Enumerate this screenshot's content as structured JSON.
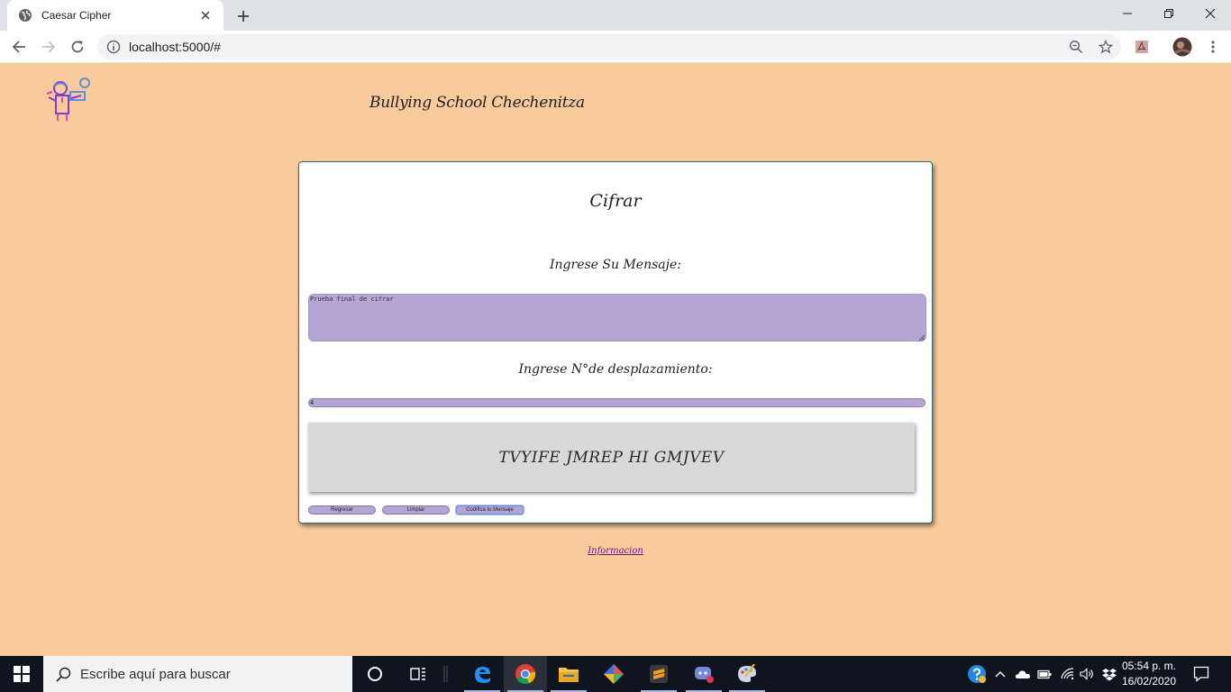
{
  "browser": {
    "tab_title": "Caesar Cipher",
    "url": "localhost:5000/#"
  },
  "page": {
    "brand": "Bullying School Chechenitza",
    "card": {
      "title": "Cifrar",
      "message_label": "Ingrese Su Mensaje:",
      "message_value": "Prueba final de cifrar",
      "shift_label": "Ingrese N°de desplazamiento:",
      "shift_value": "4",
      "result": "TVYIFE JMREP HI GMJVEV",
      "buttons": {
        "back": "Regresar",
        "clear": "Limpiar",
        "encode": "Codifica tu Mensaje"
      }
    },
    "info_link": "Informacion"
  },
  "taskbar": {
    "search_placeholder": "Escribe aquí para buscar",
    "time": "05:54 p. m.",
    "date": "16/02/2020"
  },
  "colors": {
    "page_bg": "#f8ca9c",
    "field_bg": "#b4a5d4",
    "result_bg": "#d9d9d9",
    "card_border": "#2f6e6a",
    "link": "#5b1b8f"
  }
}
